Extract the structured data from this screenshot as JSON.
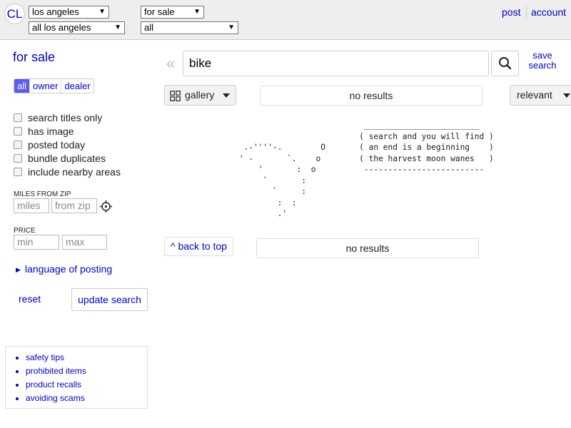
{
  "header": {
    "logo": "CL",
    "area_select": "los angeles",
    "subarea_select": "all los angeles",
    "category_select": "for sale",
    "subcategory_select": "all",
    "post_label": "post",
    "account_label": "account"
  },
  "sidebar": {
    "title": "for sale",
    "seller_types": [
      {
        "label": "all",
        "active": true
      },
      {
        "label": "owner",
        "active": false
      },
      {
        "label": "dealer",
        "active": false
      }
    ],
    "checkboxes": [
      {
        "label": "search titles only",
        "checked": false
      },
      {
        "label": "has image",
        "checked": false
      },
      {
        "label": "posted today",
        "checked": false
      },
      {
        "label": "bundle duplicates",
        "checked": false
      },
      {
        "label": "include nearby areas",
        "checked": false
      }
    ],
    "miles_label": "MILES FROM ZIP",
    "miles_placeholder": "miles",
    "zip_placeholder": "from zip",
    "price_label": "PRICE",
    "min_placeholder": "min",
    "max_placeholder": "max",
    "language_label": "language of posting",
    "reset_label": "reset",
    "update_label": "update search",
    "safety_links": [
      "safety tips",
      "prohibited items",
      "product recalls",
      "avoiding scams"
    ]
  },
  "search": {
    "query": "bike",
    "save_label": "save search"
  },
  "results": {
    "view_label": "gallery",
    "count_label": "no results",
    "sort_label": "relevant",
    "back_to_top": "^ back to top",
    "bottom_label": "no results",
    "ascii_art": "                           ________________________\n                          ( search and you will find )\n  .-''''-.        O       ( an end is a beginning    )\n ' -       `.    o        ( the harvest moon wanes   )\n     '       :  o          -------------------------\n      `       :\n        `     :\n         :  :\n         .'"
  },
  "colors": {
    "link": "#0000cc",
    "active_toggle": "#5b5bf2",
    "header_bg": "#eeeeee"
  }
}
